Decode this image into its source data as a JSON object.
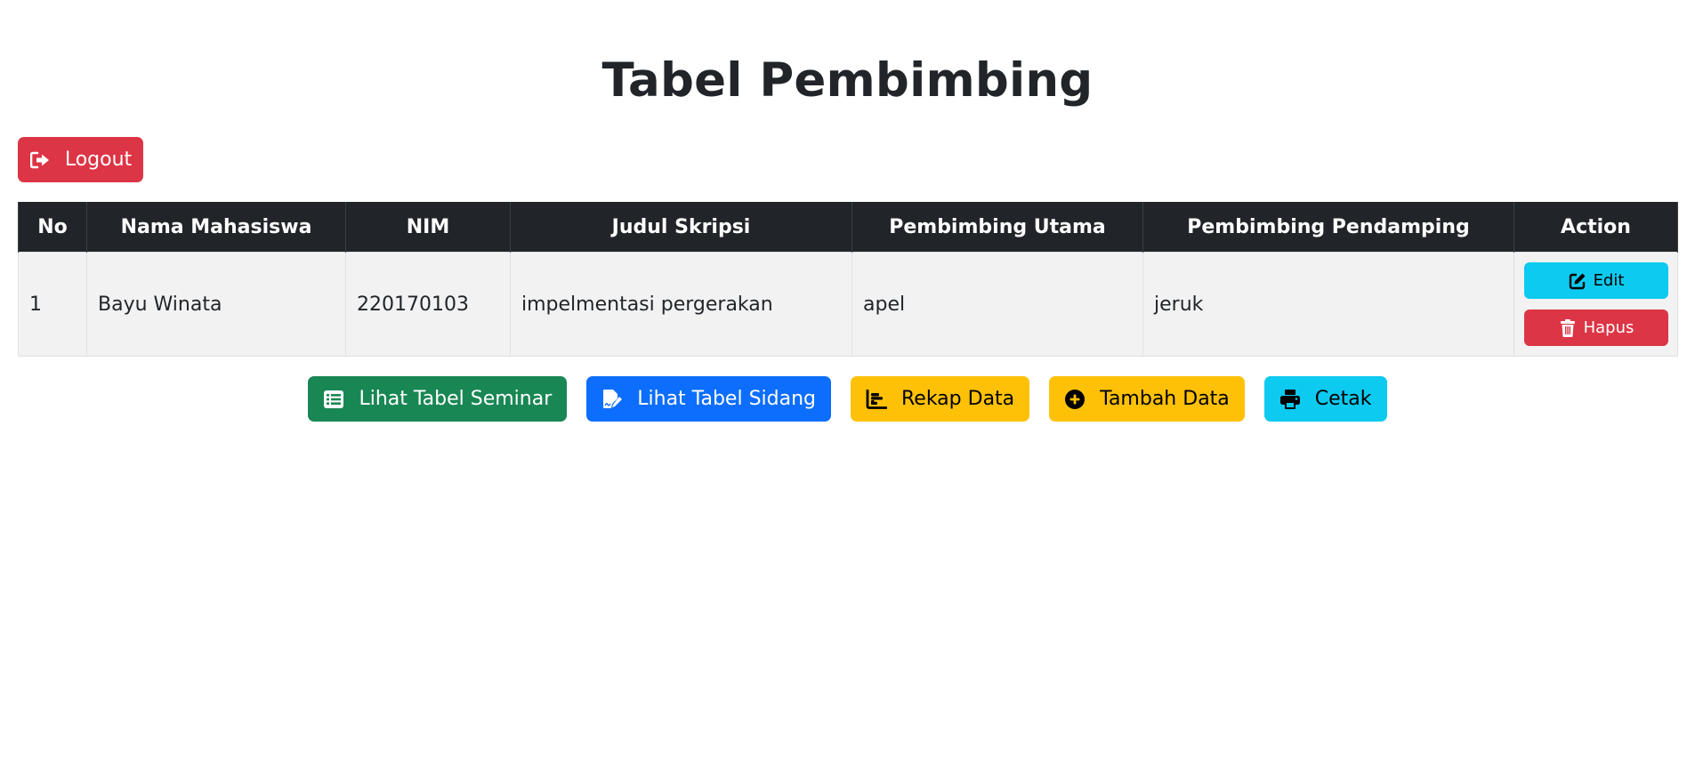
{
  "page": {
    "title": "Tabel Pembimbing"
  },
  "header": {
    "logout_label": "Logout"
  },
  "table": {
    "columns": [
      "No",
      "Nama Mahasiswa",
      "NIM",
      "Judul Skripsi",
      "Pembimbing Utama",
      "Pembimbing Pendamping",
      "Action"
    ],
    "rows": [
      {
        "no": "1",
        "nama": "Bayu Winata",
        "nim": "220170103",
        "judul": "impelmentasi pergerakan",
        "utama": "apel",
        "pendamping": "jeruk",
        "edit_label": "Edit",
        "hapus_label": "Hapus"
      }
    ]
  },
  "actions": {
    "seminar_label": "Lihat Tabel Seminar",
    "sidang_label": "Lihat Tabel Sidang",
    "rekap_label": "Rekap Data",
    "tambah_label": "Tambah Data",
    "cetak_label": "Cetak"
  },
  "colors": {
    "danger": "#dc3545",
    "success": "#198754",
    "primary": "#0d6efd",
    "warning": "#ffc107",
    "info": "#0dcaf0",
    "table_header": "#212529"
  },
  "icons": {
    "logout": "logout-icon",
    "edit": "edit-icon",
    "hapus": "trash-icon",
    "seminar": "list-table-icon",
    "sidang": "signature-icon",
    "rekap": "bar-chart-icon",
    "tambah": "plus-circle-icon",
    "cetak": "print-icon"
  }
}
